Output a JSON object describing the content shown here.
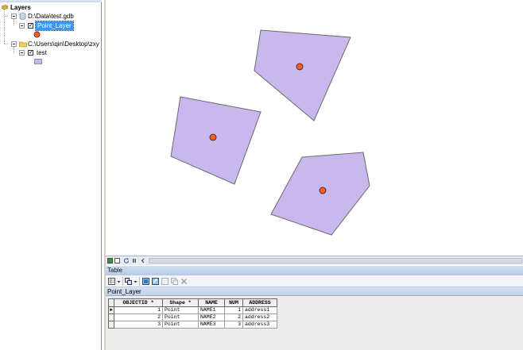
{
  "toc": {
    "root_label": "Layers",
    "groups": [
      {
        "source": "D:\\Data\\test.gdb",
        "layers": [
          {
            "name": "Point_Layer",
            "checked": true,
            "selected": true,
            "symbol": "orange-point"
          }
        ]
      },
      {
        "source": "C:\\Users\\qin\\Desktop\\zxy",
        "layers": [
          {
            "name": "test",
            "checked": true,
            "selected": false,
            "symbol": "lavender-polygon"
          }
        ]
      }
    ]
  },
  "colors": {
    "polygon_fill": "#c8b8ee",
    "polygon_stroke": "#6b6b6b",
    "point_fill": "#ff5a1f",
    "point_stroke": "#222222",
    "selection": "#3399ff"
  },
  "table_window": {
    "title": "Table",
    "layer_tab": "Point_Layer",
    "columns": [
      "",
      "OBJECTID *",
      "Shape *",
      "NAME",
      "NUM",
      "ADDRESS"
    ],
    "rows": [
      {
        "current": true,
        "OBJECTID": "1",
        "Shape": "Point",
        "NAME": "NAME1",
        "NUM": "1",
        "ADDRESS": "address1"
      },
      {
        "current": false,
        "OBJECTID": "2",
        "Shape": "Point",
        "NAME": "NAME2",
        "NUM": "2",
        "ADDRESS": "address2"
      },
      {
        "current": false,
        "OBJECTID": "3",
        "Shape": "Point",
        "NAME": "NAME3",
        "NUM": "3",
        "ADDRESS": "address3"
      }
    ],
    "current_row_marker": "►"
  },
  "icons": {
    "toc_root": "layers-icon",
    "gdb": "geodatabase-icon",
    "folder": "folder-icon",
    "checkmark": "✓"
  }
}
